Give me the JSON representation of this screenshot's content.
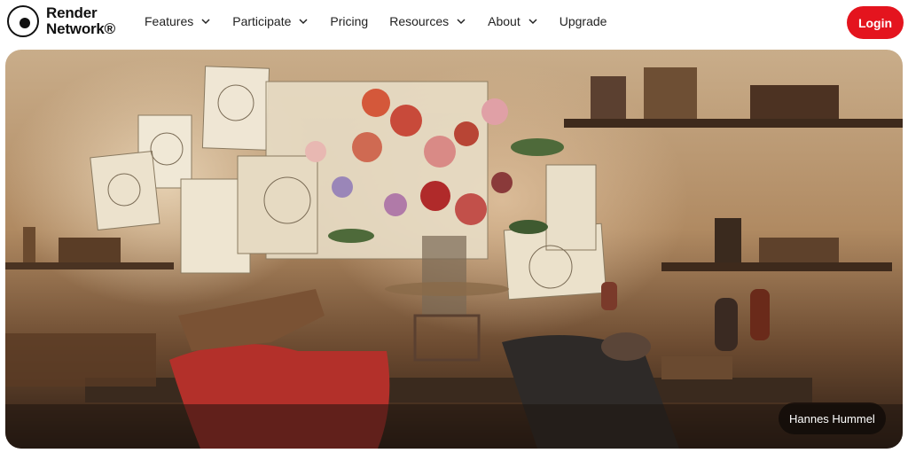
{
  "brand": {
    "line1": "Render",
    "line2": "Network®"
  },
  "nav": {
    "items": [
      {
        "label": "Features",
        "has_dropdown": true
      },
      {
        "label": "Participate",
        "has_dropdown": true
      },
      {
        "label": "Pricing",
        "has_dropdown": false
      },
      {
        "label": "Resources",
        "has_dropdown": true
      },
      {
        "label": "About",
        "has_dropdown": true
      },
      {
        "label": "Upgrade",
        "has_dropdown": false
      }
    ]
  },
  "login": {
    "label": "Login"
  },
  "hero": {
    "caption": "Hannes Hummel"
  },
  "colors": {
    "accent": "#e4141e",
    "text": "#222222",
    "caption_bg": "#0f0a08"
  },
  "icons": {
    "dropdown": "chevron-down-icon",
    "logo": "render-logo-icon"
  }
}
